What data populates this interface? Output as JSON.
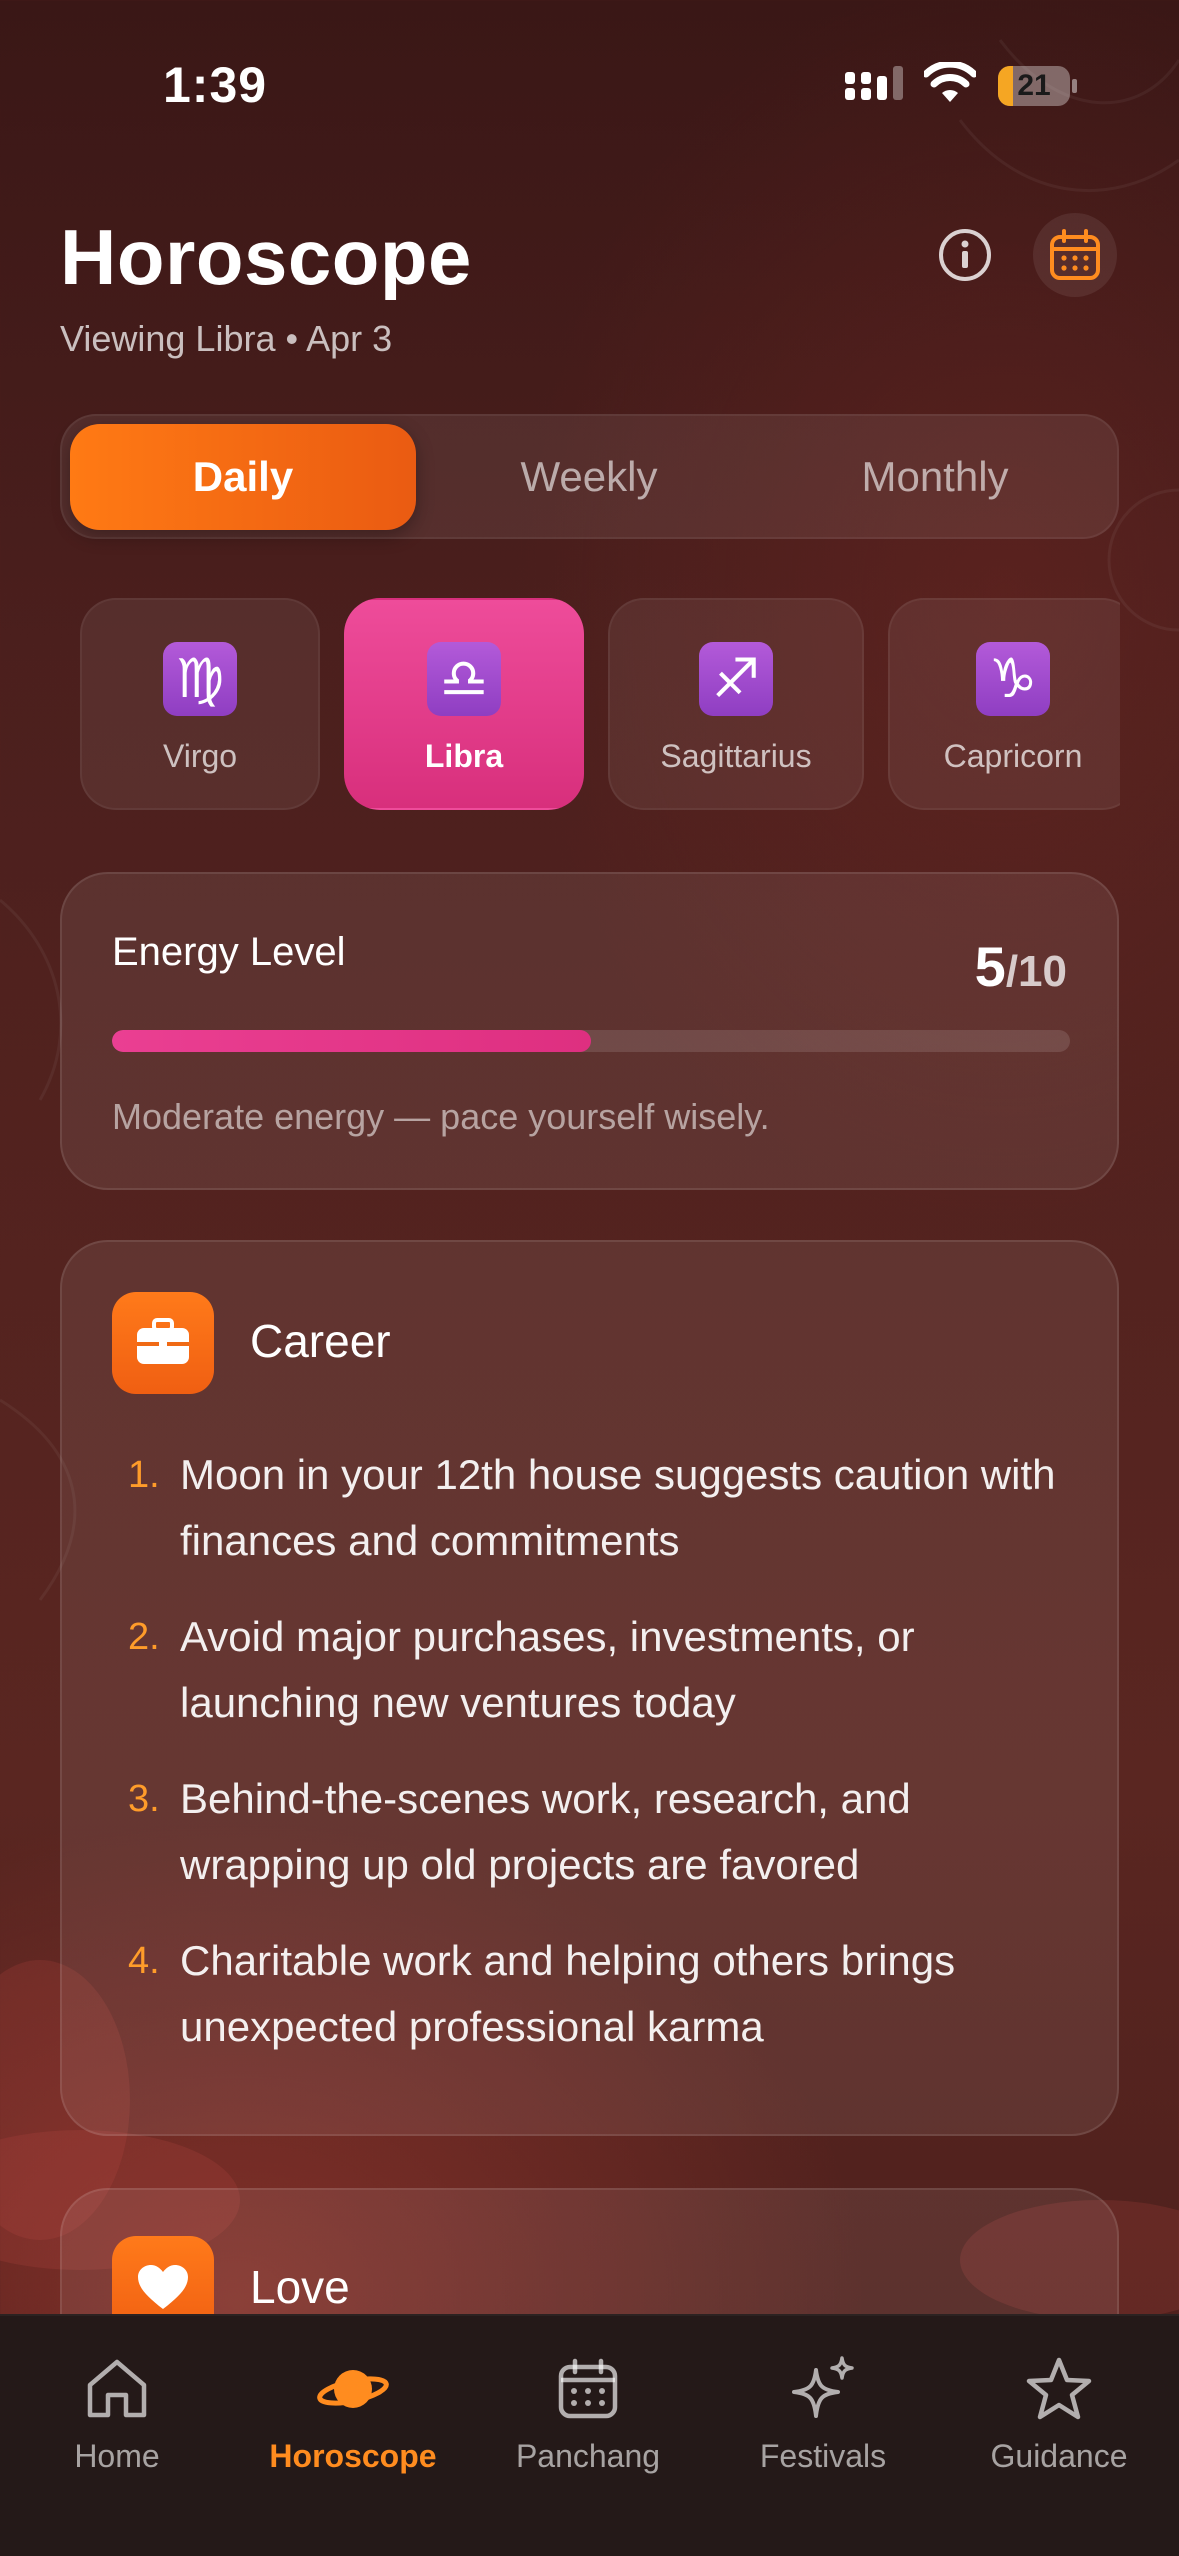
{
  "status_bar": {
    "time": "1:39",
    "battery_level": "21",
    "battery_fraction": 0.21
  },
  "header": {
    "title": "Horoscope",
    "subtitle": "Viewing Libra • Apr 3",
    "info_icon": "info-icon",
    "calendar_icon": "calendar-icon"
  },
  "period_tabs": [
    {
      "label": "Daily",
      "active": true
    },
    {
      "label": "Weekly",
      "active": false
    },
    {
      "label": "Monthly",
      "active": false
    }
  ],
  "zodiac_signs": [
    {
      "name": "Virgo",
      "glyph": "♍",
      "active": false
    },
    {
      "name": "Libra",
      "glyph": "♎",
      "active": true
    },
    {
      "name": "Sagittarius",
      "glyph": "♐",
      "active": false
    },
    {
      "name": "Capricorn",
      "glyph": "♑",
      "active": false
    }
  ],
  "energy": {
    "label": "Energy Level",
    "value": "5",
    "max": "/10",
    "fraction": 0.5,
    "description": "Moderate energy — pace yourself wisely."
  },
  "career": {
    "title": "Career",
    "icon": "briefcase-icon",
    "items": [
      {
        "num": "1.",
        "text": "Moon in your 12th house suggests caution with finances and commitments"
      },
      {
        "num": "2.",
        "text": "Avoid major purchases, investments, or launching new ventures today"
      },
      {
        "num": "3.",
        "text": "Behind-the-scenes work, research, and wrapping up old projects are favored"
      },
      {
        "num": "4.",
        "text": "Charitable work and helping others brings unexpected professional karma"
      }
    ]
  },
  "love": {
    "title": "Love",
    "icon": "heart-icon"
  },
  "tabbar": [
    {
      "label": "Home",
      "icon": "home-icon",
      "active": false
    },
    {
      "label": "Horoscope",
      "icon": "planet-icon",
      "active": true
    },
    {
      "label": "Panchang",
      "icon": "calendar-icon",
      "active": false
    },
    {
      "label": "Festivals",
      "icon": "sparkles-icon",
      "active": false
    },
    {
      "label": "Guidance",
      "icon": "star-icon",
      "active": false
    }
  ],
  "colors": {
    "accent_orange": "#ff7a14",
    "accent_pink": "#e23a8a",
    "background": "#4b1f1d"
  }
}
